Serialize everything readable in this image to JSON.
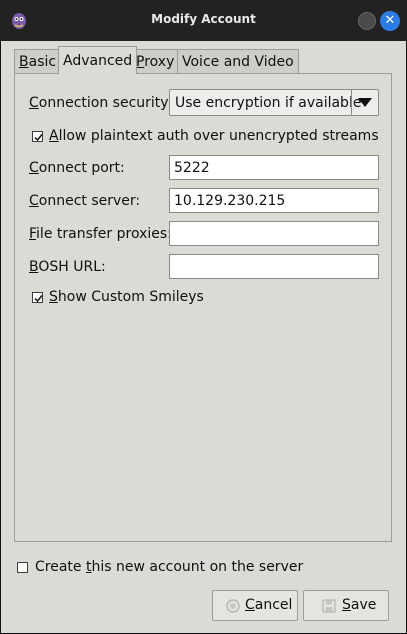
{
  "window": {
    "title": "Modify Account"
  },
  "tabs": [
    {
      "label": "Basic",
      "mnemonic": "B",
      "rest": "asic"
    },
    {
      "label": "Advanced",
      "mnemonic": "",
      "rest": "Advanced"
    },
    {
      "label": "Proxy",
      "mnemonic": "P",
      "rest": "roxy"
    },
    {
      "label": "Voice and Video",
      "mnemonic": "",
      "rest": "Voice and Video"
    }
  ],
  "advanced": {
    "connection_security": {
      "label_mnemonic": "C",
      "label_rest": "onnection security:",
      "value": "Use encryption if available"
    },
    "allow_plaintext": {
      "label_mnemonic": "A",
      "label_rest": "llow plaintext auth over unencrypted streams",
      "checked": true
    },
    "connect_port": {
      "label_mnemonic": "C",
      "label_rest": "onnect port:",
      "value": "5222"
    },
    "connect_server": {
      "label_mnemonic": "C",
      "label_rest": "onnect server:",
      "value": "10.129.230.215"
    },
    "file_transfer_proxies": {
      "label_mnemonic": "F",
      "label_rest": "ile transfer proxies:",
      "value": ""
    },
    "bosh_url": {
      "label_mnemonic": "B",
      "label_rest": "OSH URL:",
      "value": ""
    },
    "show_custom_smileys": {
      "label_mnemonic": "S",
      "label_rest": "how Custom Smileys",
      "checked": true
    }
  },
  "create_account": {
    "label_before": "Create ",
    "label_mnemonic": "t",
    "label_after": "his new account on the server",
    "checked": false
  },
  "buttons": {
    "cancel": {
      "mnemonic": "C",
      "rest": "ancel",
      "icon": "cancel-icon"
    },
    "save": {
      "mnemonic": "S",
      "rest": "ave",
      "icon": "floppy-disk-icon"
    }
  }
}
